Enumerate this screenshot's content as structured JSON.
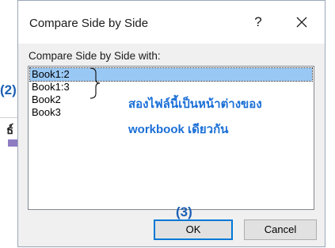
{
  "background": {
    "glyph": "ธ์",
    "swatch_color": "#8e7cc3"
  },
  "dialog": {
    "title": "Compare Side by Side",
    "help_label": "?",
    "close_icon": "close-icon",
    "section_label": "Compare Side by Side with:",
    "list_items": [
      {
        "label": "Book1:2",
        "selected": true
      },
      {
        "label": "Book1:3",
        "selected": false
      },
      {
        "label": "Book2",
        "selected": false
      },
      {
        "label": "Book3",
        "selected": false
      }
    ],
    "ok_label": "OK",
    "cancel_label": "Cancel"
  },
  "annotations": {
    "marker_2": "(2)",
    "marker_3": "(3)",
    "note_line1": "สองไฟล์นี้เป็นหน้าต่างของ",
    "note_line2": "workbook เดียวกัน",
    "color": "#1a6fd6"
  }
}
